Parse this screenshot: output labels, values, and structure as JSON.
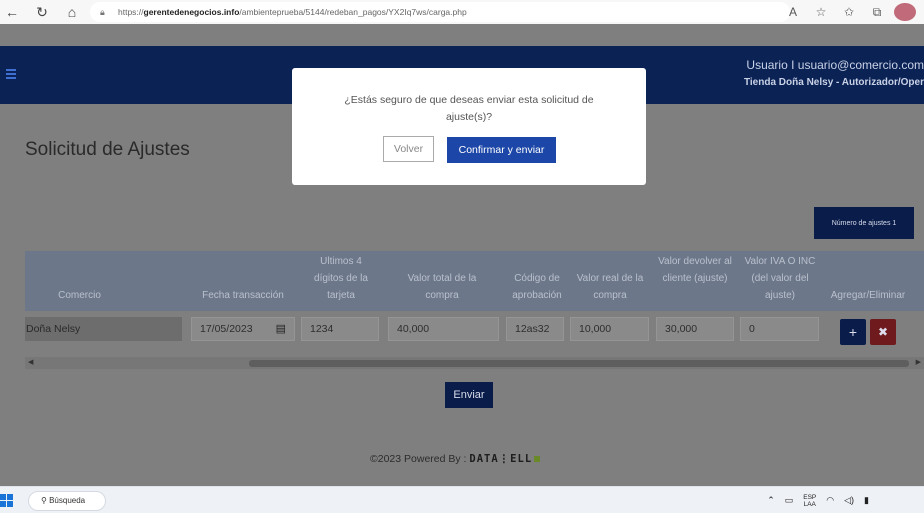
{
  "browser": {
    "url_prefix": "https://",
    "url_host": "gerentedenegocios.info",
    "url_path": "/ambienteprueba/5144/redeban_pagos/YX2Iq7ws/carga.php",
    "icons": [
      "back-icon",
      "reload-icon",
      "home-icon",
      "lock-icon",
      "read-aloud-icon",
      "favorite-add-icon",
      "favorites-icon",
      "collections-icon"
    ]
  },
  "header": {
    "user_line": "Usuario I usuario@comercio.com",
    "store_line": "Tienda Doña Nelsy - Autorizador/Oper"
  },
  "page": {
    "title": "Solicitud de Ajustes",
    "adjust_count_button": "Número de ajustes 1",
    "send_button": "Enviar"
  },
  "table": {
    "headers": [
      "Comercio",
      "Fecha transacción",
      "Ultimos 4 dígitos de la tarjeta",
      "Valor total de la compra",
      "Código de aprobación",
      "Valor real de la compra",
      "Valor devolver al cliente (ajuste)",
      "Valor IVA O INC (del valor del ajuste)",
      "Agregar/Eliminar"
    ],
    "row": {
      "comercio": "Doña Nelsy",
      "fecha": "17/05/2023",
      "digitos": "1234",
      "valor_total": "40,000",
      "codigo": "12as32",
      "valor_real": "10,000",
      "valor_devolver": "30,000",
      "valor_iva": "0"
    },
    "add_symbol": "+",
    "delete_symbol": "✖"
  },
  "modal": {
    "message": "¿Estás seguro de que deseas enviar esta solicitud de ajuste(s)?",
    "cancel_label": "Volver",
    "confirm_label": "Confirmar y enviar"
  },
  "footer": {
    "text": "©2023 Powered By :",
    "brand": "DATA⋮ELL"
  },
  "taskbar": {
    "search_label": "Búsqueda",
    "lang_top": "ESP",
    "lang_bottom": "LAA"
  },
  "colors": {
    "nav": "#0b2255",
    "primary_button": "#1c47a8",
    "delete_button": "#6f1a1d"
  }
}
